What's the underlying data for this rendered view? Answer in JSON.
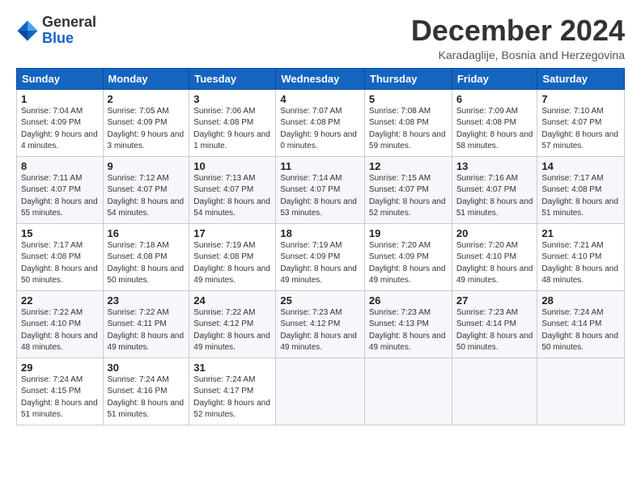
{
  "logo": {
    "general": "General",
    "blue": "Blue"
  },
  "header": {
    "month": "December 2024",
    "location": "Karadaglije, Bosnia and Herzegovina"
  },
  "weekdays": [
    "Sunday",
    "Monday",
    "Tuesday",
    "Wednesday",
    "Thursday",
    "Friday",
    "Saturday"
  ],
  "weeks": [
    [
      {
        "day": 1,
        "sunrise": "7:04 AM",
        "sunset": "4:09 PM",
        "daylight": "9 hours and 4 minutes."
      },
      {
        "day": 2,
        "sunrise": "7:05 AM",
        "sunset": "4:09 PM",
        "daylight": "9 hours and 3 minutes."
      },
      {
        "day": 3,
        "sunrise": "7:06 AM",
        "sunset": "4:08 PM",
        "daylight": "9 hours and 1 minute."
      },
      {
        "day": 4,
        "sunrise": "7:07 AM",
        "sunset": "4:08 PM",
        "daylight": "9 hours and 0 minutes."
      },
      {
        "day": 5,
        "sunrise": "7:08 AM",
        "sunset": "4:08 PM",
        "daylight": "8 hours and 59 minutes."
      },
      {
        "day": 6,
        "sunrise": "7:09 AM",
        "sunset": "4:08 PM",
        "daylight": "8 hours and 58 minutes."
      },
      {
        "day": 7,
        "sunrise": "7:10 AM",
        "sunset": "4:07 PM",
        "daylight": "8 hours and 57 minutes."
      }
    ],
    [
      {
        "day": 8,
        "sunrise": "7:11 AM",
        "sunset": "4:07 PM",
        "daylight": "8 hours and 55 minutes."
      },
      {
        "day": 9,
        "sunrise": "7:12 AM",
        "sunset": "4:07 PM",
        "daylight": "8 hours and 54 minutes."
      },
      {
        "day": 10,
        "sunrise": "7:13 AM",
        "sunset": "4:07 PM",
        "daylight": "8 hours and 54 minutes."
      },
      {
        "day": 11,
        "sunrise": "7:14 AM",
        "sunset": "4:07 PM",
        "daylight": "8 hours and 53 minutes."
      },
      {
        "day": 12,
        "sunrise": "7:15 AM",
        "sunset": "4:07 PM",
        "daylight": "8 hours and 52 minutes."
      },
      {
        "day": 13,
        "sunrise": "7:16 AM",
        "sunset": "4:07 PM",
        "daylight": "8 hours and 51 minutes."
      },
      {
        "day": 14,
        "sunrise": "7:17 AM",
        "sunset": "4:08 PM",
        "daylight": "8 hours and 51 minutes."
      }
    ],
    [
      {
        "day": 15,
        "sunrise": "7:17 AM",
        "sunset": "4:08 PM",
        "daylight": "8 hours and 50 minutes."
      },
      {
        "day": 16,
        "sunrise": "7:18 AM",
        "sunset": "4:08 PM",
        "daylight": "8 hours and 50 minutes."
      },
      {
        "day": 17,
        "sunrise": "7:19 AM",
        "sunset": "4:08 PM",
        "daylight": "8 hours and 49 minutes."
      },
      {
        "day": 18,
        "sunrise": "7:19 AM",
        "sunset": "4:09 PM",
        "daylight": "8 hours and 49 minutes."
      },
      {
        "day": 19,
        "sunrise": "7:20 AM",
        "sunset": "4:09 PM",
        "daylight": "8 hours and 49 minutes."
      },
      {
        "day": 20,
        "sunrise": "7:20 AM",
        "sunset": "4:10 PM",
        "daylight": "8 hours and 49 minutes."
      },
      {
        "day": 21,
        "sunrise": "7:21 AM",
        "sunset": "4:10 PM",
        "daylight": "8 hours and 48 minutes."
      }
    ],
    [
      {
        "day": 22,
        "sunrise": "7:22 AM",
        "sunset": "4:10 PM",
        "daylight": "8 hours and 48 minutes."
      },
      {
        "day": 23,
        "sunrise": "7:22 AM",
        "sunset": "4:11 PM",
        "daylight": "8 hours and 49 minutes."
      },
      {
        "day": 24,
        "sunrise": "7:22 AM",
        "sunset": "4:12 PM",
        "daylight": "8 hours and 49 minutes."
      },
      {
        "day": 25,
        "sunrise": "7:23 AM",
        "sunset": "4:12 PM",
        "daylight": "8 hours and 49 minutes."
      },
      {
        "day": 26,
        "sunrise": "7:23 AM",
        "sunset": "4:13 PM",
        "daylight": "8 hours and 49 minutes."
      },
      {
        "day": 27,
        "sunrise": "7:23 AM",
        "sunset": "4:14 PM",
        "daylight": "8 hours and 50 minutes."
      },
      {
        "day": 28,
        "sunrise": "7:24 AM",
        "sunset": "4:14 PM",
        "daylight": "8 hours and 50 minutes."
      }
    ],
    [
      {
        "day": 29,
        "sunrise": "7:24 AM",
        "sunset": "4:15 PM",
        "daylight": "8 hours and 51 minutes."
      },
      {
        "day": 30,
        "sunrise": "7:24 AM",
        "sunset": "4:16 PM",
        "daylight": "8 hours and 51 minutes."
      },
      {
        "day": 31,
        "sunrise": "7:24 AM",
        "sunset": "4:17 PM",
        "daylight": "8 hours and 52 minutes."
      },
      null,
      null,
      null,
      null
    ]
  ]
}
